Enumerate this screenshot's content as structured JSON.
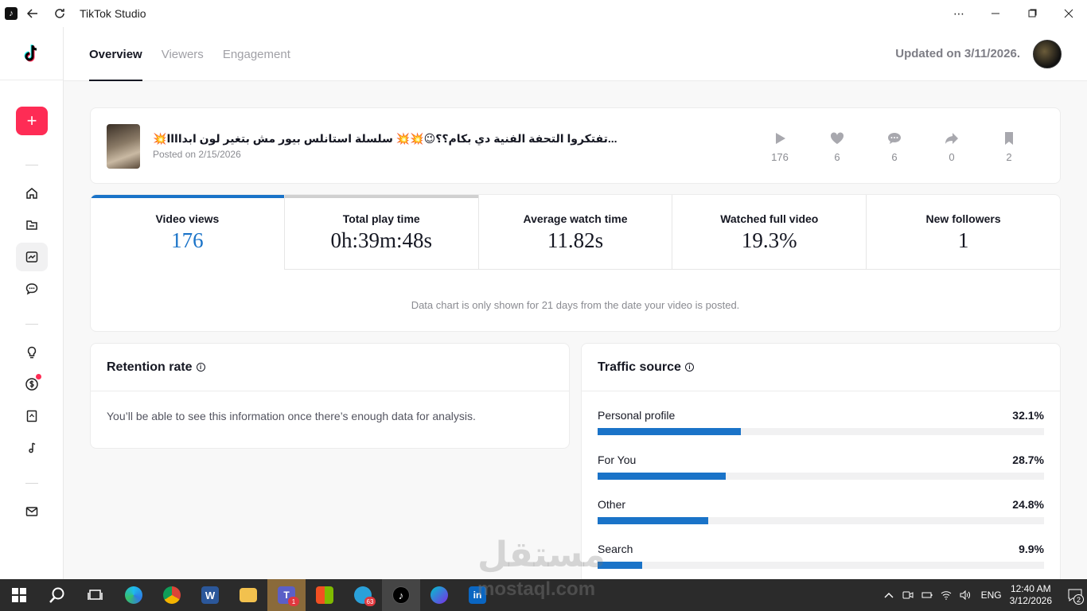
{
  "window": {
    "title": "TikTok Studio"
  },
  "header": {
    "tabs": [
      {
        "label": "Overview",
        "active": true
      },
      {
        "label": "Viewers",
        "active": false
      },
      {
        "label": "Engagement",
        "active": false
      }
    ],
    "updated": "Updated on 3/11/2026."
  },
  "video": {
    "title": "💥تفتكروا التحفة الفنية دي بكام؟؟😉💥💥 سلسلة استانلس بيور مش بتغير لون ابداااا...",
    "posted": "Posted on 2/15/2026",
    "stats": {
      "views": "176",
      "likes": "6",
      "comments": "6",
      "shares": "0",
      "saves": "2"
    }
  },
  "metrics": [
    {
      "label": "Video views",
      "value": "176"
    },
    {
      "label": "Total play time",
      "value": "0h:39m:48s"
    },
    {
      "label": "Average watch time",
      "value": "11.82s"
    },
    {
      "label": "Watched full video",
      "value": "19.3%"
    },
    {
      "label": "New followers",
      "value": "1"
    }
  ],
  "chart_note": "Data chart is only shown for 21 days from the date your video is posted.",
  "retention": {
    "title": "Retention rate",
    "message": "You’ll be able to see this information once there’s enough data for analysis."
  },
  "traffic": {
    "title": "Traffic source",
    "items": [
      {
        "label": "Personal profile",
        "pct_label": "32.1%",
        "pct": 32.1
      },
      {
        "label": "For You",
        "pct_label": "28.7%",
        "pct": 28.7
      },
      {
        "label": "Other",
        "pct_label": "24.8%",
        "pct": 24.8
      },
      {
        "label": "Search",
        "pct_label": "9.9%",
        "pct": 9.9
      }
    ]
  },
  "watermark": {
    "main": "مستقل",
    "sub": "mostaql.com"
  },
  "taskbar": {
    "badges": {
      "teams": "1",
      "telegram": "63"
    },
    "lang": "ENG",
    "time": "12:40 AM",
    "date": "3/12/2026",
    "notifications": "2"
  },
  "colors": {
    "accent": "#1a73c8",
    "brand": "#fe2c55"
  }
}
